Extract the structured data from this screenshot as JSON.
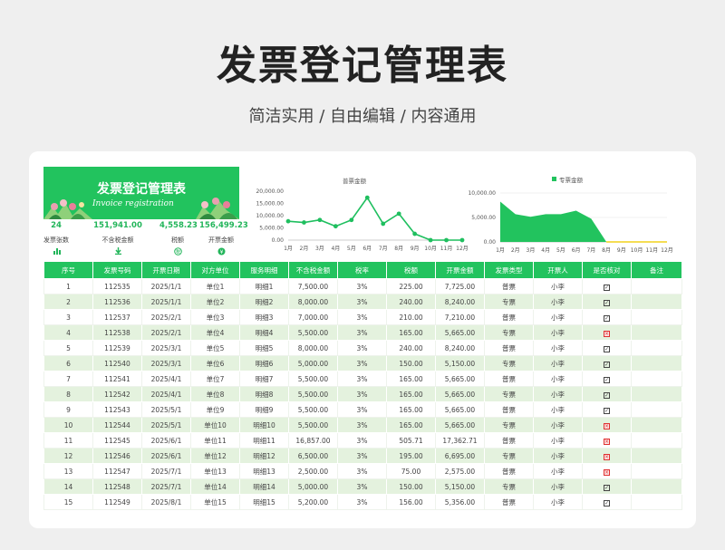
{
  "header": {
    "title": "发票登记管理表",
    "subtitle": "简洁实用 / 自由编辑 / 内容通用"
  },
  "banner": {
    "title": "发票登记管理表",
    "subtitle": "Invoice registration"
  },
  "stats": [
    {
      "value": "24",
      "label": "发票张数",
      "icon": "bar-chart-icon"
    },
    {
      "value": "151,941.00",
      "label": "不含税金额",
      "icon": "download-icon"
    },
    {
      "value": "4,558.23",
      "label": "税额",
      "icon": "tax-icon"
    },
    {
      "value": "156,499.23",
      "label": "开票金额",
      "icon": "currency-icon"
    }
  ],
  "colors": {
    "accent": "#22c35e",
    "row_alt": "#e4f2de",
    "line": "#1fbf5f",
    "invalid": "#e03030"
  },
  "chart_data": [
    {
      "type": "line",
      "title": "普票金额",
      "categories": [
        "1月",
        "2月",
        "3月",
        "4月",
        "5月",
        "6月",
        "7月",
        "8月",
        "9月",
        "10月",
        "11月",
        "12月"
      ],
      "values": [
        7725,
        7210,
        8240,
        5665,
        8240,
        17362.71,
        6695,
        10800,
        2575,
        0,
        0,
        0
      ],
      "ylim": [
        0,
        20000
      ],
      "yticks": [
        "20,000.00",
        "15,000.00",
        "10,000.00",
        "5,000.00",
        "0.00"
      ]
    },
    {
      "type": "area",
      "title": "专票金额",
      "categories": [
        "1月",
        "2月",
        "3月",
        "4月",
        "5月",
        "6月",
        "7月",
        "8月",
        "9月",
        "10月",
        "11月",
        "12月"
      ],
      "values": [
        8240,
        5665,
        5150,
        5665,
        5665,
        6400,
        4750,
        0,
        0,
        0,
        0,
        0
      ],
      "ylim": [
        0,
        10000
      ],
      "yticks": [
        "10,000.00",
        "5,000.00",
        "0.00"
      ]
    }
  ],
  "table": {
    "headers": [
      "序号",
      "发票号码",
      "开票日期",
      "对方单位",
      "服务明细",
      "不含税金额",
      "税率",
      "税额",
      "开票金额",
      "发票类型",
      "开票人",
      "是否核对",
      "备注"
    ],
    "rows": [
      [
        "1",
        "112535",
        "2025/1/1",
        "单位1",
        "明细1",
        "7,500.00",
        "3%",
        "225.00",
        "7,725.00",
        "普票",
        "小李",
        "ok",
        ""
      ],
      [
        "2",
        "112536",
        "2025/1/1",
        "单位2",
        "明细2",
        "8,000.00",
        "3%",
        "240.00",
        "8,240.00",
        "专票",
        "小李",
        "ok",
        ""
      ],
      [
        "3",
        "112537",
        "2025/2/1",
        "单位3",
        "明细3",
        "7,000.00",
        "3%",
        "210.00",
        "7,210.00",
        "普票",
        "小李",
        "ok",
        ""
      ],
      [
        "4",
        "112538",
        "2025/2/1",
        "单位4",
        "明细4",
        "5,500.00",
        "3%",
        "165.00",
        "5,665.00",
        "专票",
        "小李",
        "no",
        ""
      ],
      [
        "5",
        "112539",
        "2025/3/1",
        "单位5",
        "明细5",
        "8,000.00",
        "3%",
        "240.00",
        "8,240.00",
        "普票",
        "小李",
        "ok",
        ""
      ],
      [
        "6",
        "112540",
        "2025/3/1",
        "单位6",
        "明细6",
        "5,000.00",
        "3%",
        "150.00",
        "5,150.00",
        "专票",
        "小李",
        "ok",
        ""
      ],
      [
        "7",
        "112541",
        "2025/4/1",
        "单位7",
        "明细7",
        "5,500.00",
        "3%",
        "165.00",
        "5,665.00",
        "普票",
        "小李",
        "ok",
        ""
      ],
      [
        "8",
        "112542",
        "2025/4/1",
        "单位8",
        "明细8",
        "5,500.00",
        "3%",
        "165.00",
        "5,665.00",
        "专票",
        "小李",
        "ok",
        ""
      ],
      [
        "9",
        "112543",
        "2025/5/1",
        "单位9",
        "明细9",
        "5,500.00",
        "3%",
        "165.00",
        "5,665.00",
        "普票",
        "小李",
        "ok",
        ""
      ],
      [
        "10",
        "112544",
        "2025/5/1",
        "单位10",
        "明细10",
        "5,500.00",
        "3%",
        "165.00",
        "5,665.00",
        "专票",
        "小李",
        "no",
        ""
      ],
      [
        "11",
        "112545",
        "2025/6/1",
        "单位11",
        "明细11",
        "16,857.00",
        "3%",
        "505.71",
        "17,362.71",
        "普票",
        "小李",
        "no",
        ""
      ],
      [
        "12",
        "112546",
        "2025/6/1",
        "单位12",
        "明细12",
        "6,500.00",
        "3%",
        "195.00",
        "6,695.00",
        "专票",
        "小李",
        "no",
        ""
      ],
      [
        "13",
        "112547",
        "2025/7/1",
        "单位13",
        "明细13",
        "2,500.00",
        "3%",
        "75.00",
        "2,575.00",
        "普票",
        "小李",
        "no",
        ""
      ],
      [
        "14",
        "112548",
        "2025/7/1",
        "单位14",
        "明细14",
        "5,000.00",
        "3%",
        "150.00",
        "5,150.00",
        "专票",
        "小李",
        "ok",
        ""
      ],
      [
        "15",
        "112549",
        "2025/8/1",
        "单位15",
        "明细15",
        "5,200.00",
        "3%",
        "156.00",
        "5,356.00",
        "普票",
        "小李",
        "ok",
        ""
      ]
    ]
  }
}
